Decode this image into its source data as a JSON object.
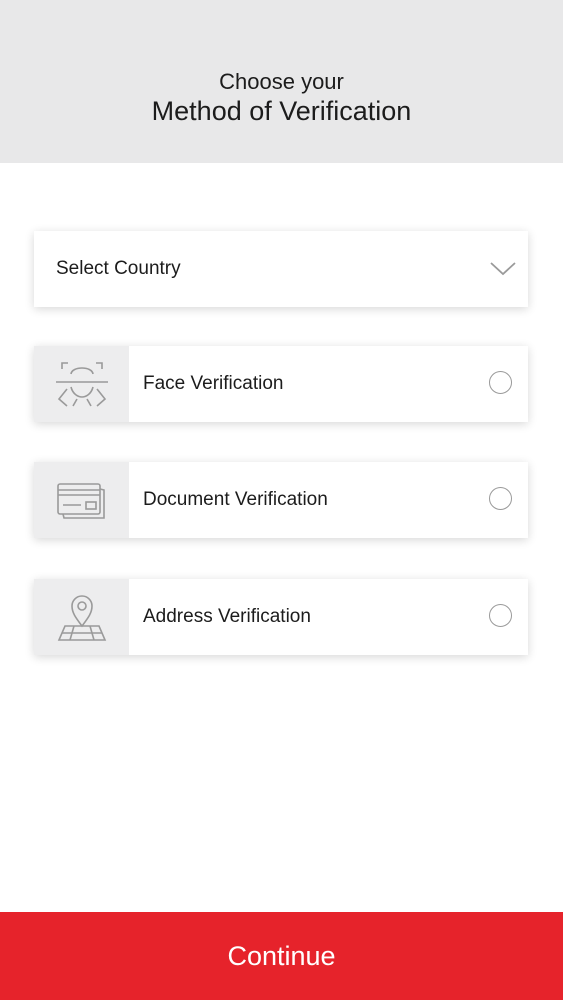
{
  "header": {
    "line1": "Choose your",
    "line2": "Method of Verification",
    "background": "#e8e8e9"
  },
  "country_select": {
    "label": "Select Country",
    "icon": "chevron-down-icon"
  },
  "options": [
    {
      "label": "Face Verification",
      "icon": "face-scan-icon",
      "selected": false
    },
    {
      "label": "Document Verification",
      "icon": "id-card-icon",
      "selected": false
    },
    {
      "label": "Address Verification",
      "icon": "map-pin-icon",
      "selected": false
    }
  ],
  "continue_button": {
    "label": "Continue",
    "color": "#e6232b"
  },
  "colors": {
    "accent": "#e6232b",
    "icon_stroke": "#9a9a9a",
    "icon_cell_bg": "#ededee"
  }
}
